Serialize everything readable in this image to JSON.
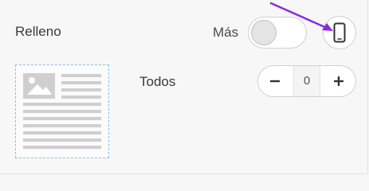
{
  "padding": {
    "title": "Relleno",
    "more_label": "Más",
    "toggle_on": false,
    "device_icon": "mobile-phone-icon",
    "all": {
      "label": "Todos",
      "value": "0",
      "decrement_icon": "minus-icon",
      "increment_icon": "plus-icon"
    },
    "preview_icon": "image-text-preview-icon"
  },
  "colors": {
    "annotation_arrow": "#8a2be2",
    "preview_border": "#8fbde0",
    "preview_glyph": "#cfcfcf"
  }
}
